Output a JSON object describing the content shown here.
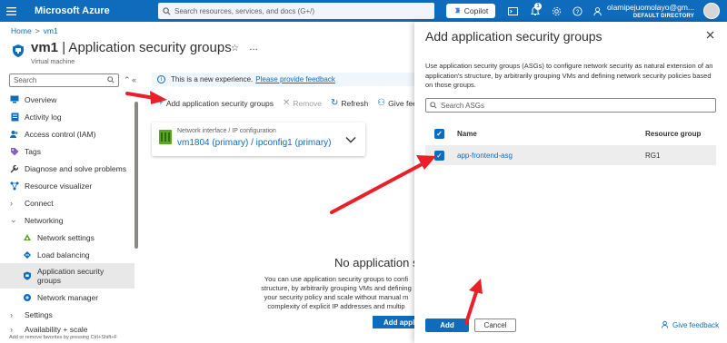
{
  "topbar": {
    "brand": "Microsoft Azure",
    "search_placeholder": "Search resources, services, and docs (G+/)",
    "copilot_label": "Copilot",
    "notification_count": "1",
    "account_email": "olamipejuomolayo@gm...",
    "account_directory": "DEFAULT DIRECTORY"
  },
  "breadcrumb": {
    "items": [
      "Home",
      "vm1"
    ],
    "separator": ">"
  },
  "header": {
    "title_resource": "vm1",
    "title_page": " | Application security groups",
    "subtitle": "Virtual machine",
    "favorite_icon": "☆",
    "more_icon": "…"
  },
  "sidebar": {
    "search_placeholder": "Search",
    "items": [
      {
        "label": "Overview"
      },
      {
        "label": "Activity log"
      },
      {
        "label": "Access control (IAM)"
      },
      {
        "label": "Tags"
      },
      {
        "label": "Diagnose and solve problems"
      },
      {
        "label": "Resource visualizer"
      },
      {
        "label": "Connect"
      },
      {
        "label": "Networking"
      },
      {
        "label": "Network settings"
      },
      {
        "label": "Load balancing"
      },
      {
        "label": "Application security groups"
      },
      {
        "label": "Network manager"
      },
      {
        "label": "Settings"
      },
      {
        "label": "Availability + scale"
      }
    ],
    "footer": "Add or remove favorites by pressing Ctrl+Shift+F"
  },
  "main": {
    "notice_text": "This is a new experience.",
    "notice_link": "Please provide feedback",
    "toolbar": {
      "add": "Add application security groups",
      "remove": "Remove",
      "refresh": "Refresh",
      "feedback": "Give feedback"
    },
    "nic": {
      "label": "Network interface / IP configuration",
      "value": "vm1804 (primary) / ipconfig1 (primary)"
    },
    "empty_title": "No application s",
    "empty_desc": "You can use application security groups to confi structure, by arbitrarily grouping VMs and defining your security policy and scale without manual m complexity of explicit IP addresses and multip",
    "add_button": "Add applicatio"
  },
  "panel": {
    "title": "Add application security groups",
    "description": "Use application security groups (ASGs) to configure network security as natural extension of an application's structure, by arbitrarily grouping VMs and defining network security policies based on those groups.",
    "search_placeholder": "Search ASGs",
    "columns": {
      "name": "Name",
      "resource_group": "Resource group"
    },
    "rows": [
      {
        "name": "app-frontend-asg",
        "resource_group": "RG1",
        "selected": true
      }
    ],
    "add_button": "Add",
    "cancel_button": "Cancel",
    "feedback": "Give feedback"
  },
  "colors": {
    "azure_blue": "#0f6cbd",
    "annotation_red": "#e8202a"
  }
}
